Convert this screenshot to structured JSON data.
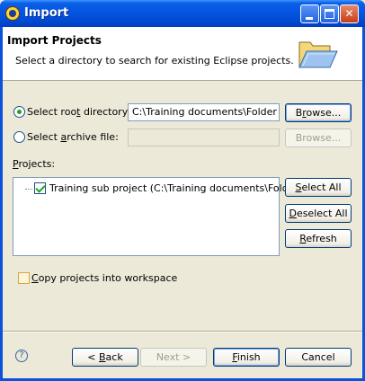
{
  "window": {
    "title": "Import"
  },
  "header": {
    "title": "Import Projects",
    "description": "Select a directory to search for existing Eclipse projects."
  },
  "root_directory": {
    "label_pre": "Select roo",
    "label_mnemonic": "t",
    "label_post": " directory:",
    "value": "C:\\Training documents\\Folder",
    "selected": true,
    "browse_pre": "B",
    "browse_mnemonic": "r",
    "browse_post": "owse..."
  },
  "archive_file": {
    "label_pre": "Select ",
    "label_mnemonic": "a",
    "label_post": "rchive file:",
    "value": "",
    "selected": false,
    "browse_label": "Browse..."
  },
  "projects": {
    "label_mnemonic": "P",
    "label_post": "rojects:",
    "items": [
      {
        "label": "Training sub project (C:\\Training documents\\Folder)",
        "checked": true
      }
    ],
    "select_all_pre": "",
    "select_all_mnemonic": "S",
    "select_all_post": "elect All",
    "deselect_all_pre": "",
    "deselect_all_mnemonic": "D",
    "deselect_all_post": "eselect All",
    "refresh_pre": "",
    "refresh_mnemonic": "R",
    "refresh_post": "efresh"
  },
  "copy_option": {
    "label_mnemonic": "C",
    "label_post": "opy projects into workspace",
    "checked": false
  },
  "footer": {
    "help_glyph": "?",
    "back_pre": "< ",
    "back_mnemonic": "B",
    "back_post": "ack",
    "next_label": "Next >",
    "finish_mnemonic": "F",
    "finish_post": "inish",
    "cancel_label": "Cancel"
  },
  "icons": {
    "window_icon": "eclipse-icon",
    "header_icon": "open-folder-icon",
    "help_icon": "help-icon"
  }
}
